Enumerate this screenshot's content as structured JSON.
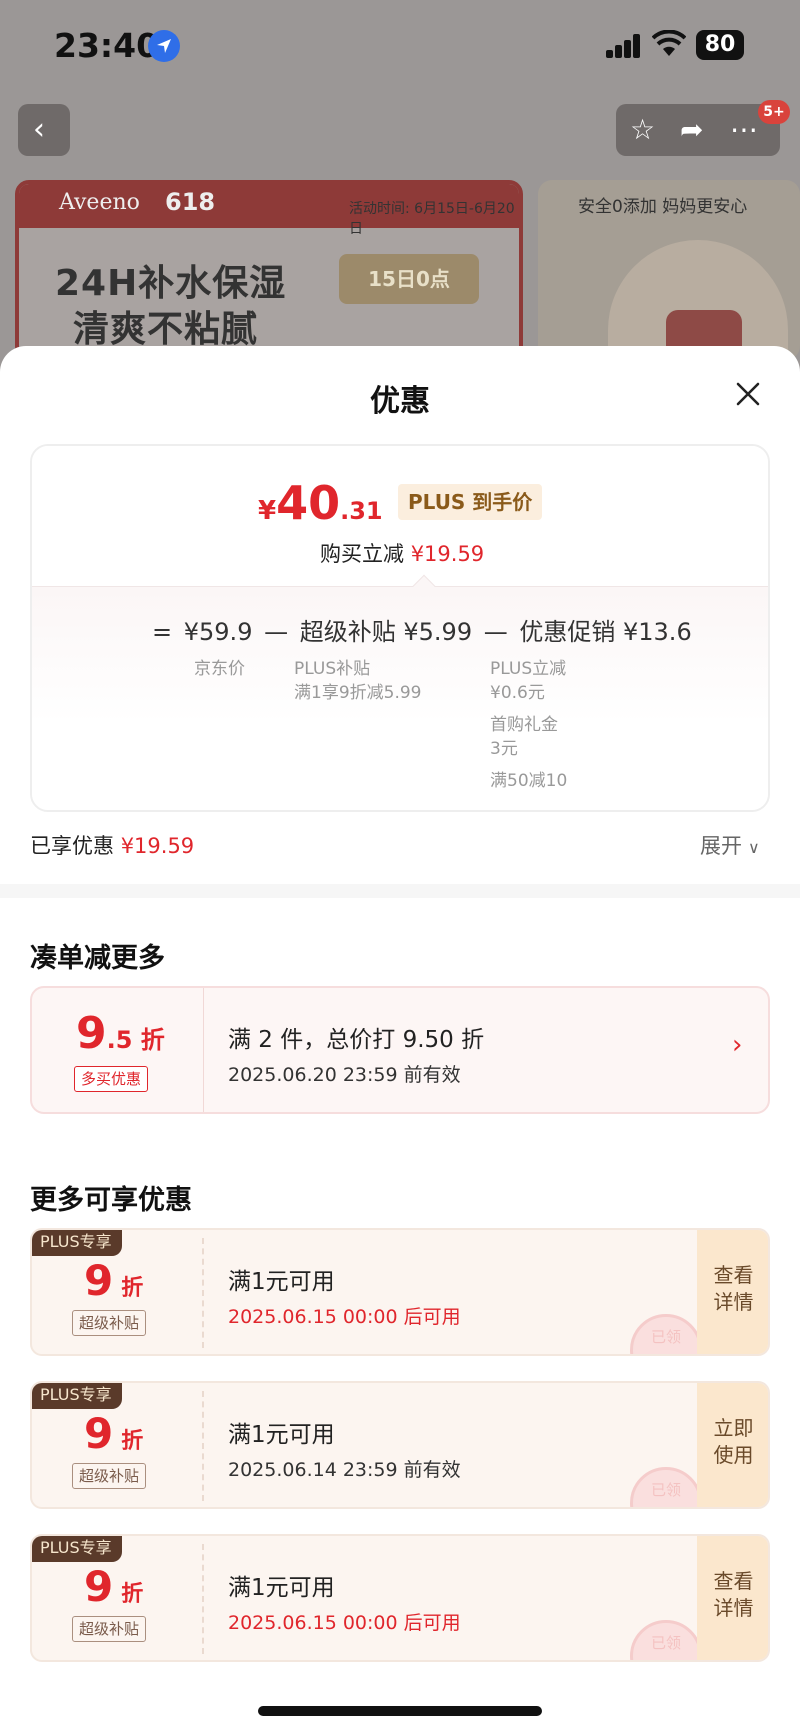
{
  "status_bar": {
    "time": "23:40",
    "battery": "80"
  },
  "background_page": {
    "banner1": {
      "brand": "Aveeno",
      "event": "618",
      "date_text": "活动时间: 6月15日-6月20日",
      "headline1": "24H补水保湿",
      "headline2": "清爽不粘腻",
      "promo": "15日0点"
    },
    "banner2": {
      "text": "安全0添加 妈妈更安心"
    },
    "badge": "5+"
  },
  "sheet": {
    "title": "优惠",
    "price_card": {
      "currency": "¥",
      "price_int": "40",
      "price_dec": ".31",
      "plus_label": "PLUS 到手价",
      "cut_label": "购买立减",
      "cut_value": "¥19.59",
      "equals": "=",
      "minus": "—",
      "jd_price": "¥59.9",
      "jd_label": "京东价",
      "super_subsidy": "超级补贴 ¥5.99",
      "super_sub1": "PLUS补贴",
      "super_sub2": "满1享9折减5.99",
      "promo": "优惠促销 ¥13.6",
      "promo_sub1": "PLUS立减",
      "promo_sub2": "¥0.6元",
      "promo_sub3": "首购礼金",
      "promo_sub4": "3元",
      "promo_sub5": "满50减10"
    },
    "enjoyed_label": "已享优惠",
    "enjoyed_value": "¥19.59",
    "expand_label": "展开",
    "combo_section": {
      "title": "凑单减更多",
      "disc_big": "9",
      "disc_small": ".5 折",
      "tag": "多买优惠",
      "desc": "满 2 件，总价打 9.50 折",
      "date": "2025.06.20 23:59 前有效"
    },
    "more_section": {
      "title": "更多可享优惠",
      "coupons": [
        {
          "plus": "PLUS专享",
          "disc": "9",
          "unit": "折",
          "tag": "超级补贴",
          "title": "满1元可用",
          "date": "2025.06.15 00:00 后可用",
          "date_color": "#e0262c",
          "action1": "查看",
          "action2": "详情",
          "stamp": "已领"
        },
        {
          "plus": "PLUS专享",
          "disc": "9",
          "unit": "折",
          "tag": "超级补贴",
          "title": "满1元可用",
          "date": "2025.06.14 23:59 前有效",
          "date_color": "#333333",
          "action1": "立即",
          "action2": "使用",
          "stamp": "已领"
        },
        {
          "plus": "PLUS专享",
          "disc": "9",
          "unit": "折",
          "tag": "超级补贴",
          "title": "满1元可用",
          "date": "2025.06.15 00:00 后可用",
          "date_color": "#e0262c",
          "action1": "查看",
          "action2": "详情",
          "stamp": "已领"
        }
      ]
    }
  },
  "colors": {
    "accent_red": "#e0262c",
    "plus_brown": "#5a3a2a",
    "coupon_bg": "#fcf5f0"
  }
}
